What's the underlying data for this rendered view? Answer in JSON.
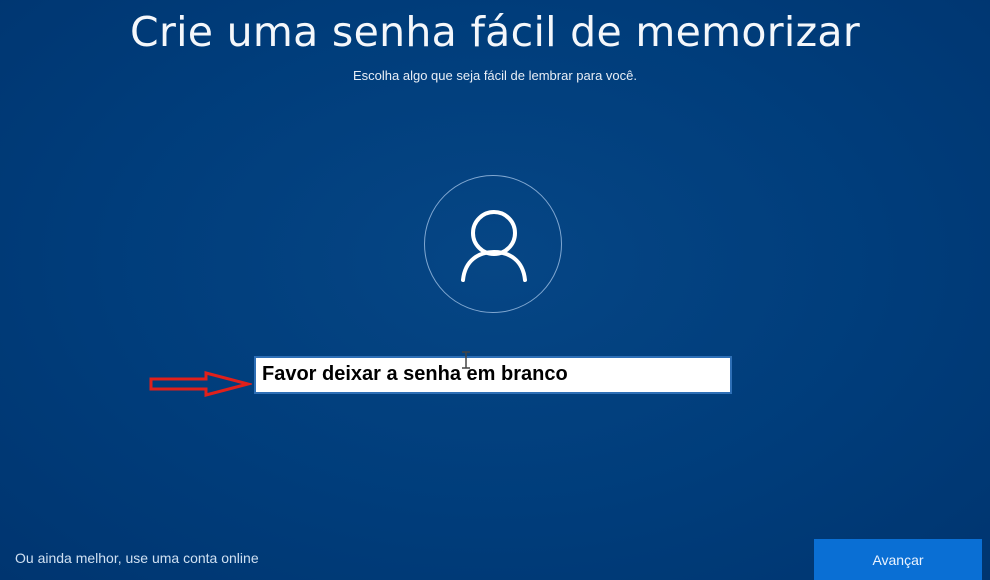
{
  "page": {
    "title": "Crie uma senha fácil de memorizar",
    "subtitle": "Escolha algo que seja fácil de lembrar para você."
  },
  "avatar": {
    "icon": "user-icon"
  },
  "password_field": {
    "value": "Favor deixar a senha em branco"
  },
  "annotation": {
    "icon": "red-arrow-right-icon",
    "color": "#e0201b"
  },
  "footer": {
    "online_account_link": "Ou ainda melhor, use uma conta online",
    "next_button": "Avançar"
  },
  "colors": {
    "background": "#003a78",
    "accent_button": "#0a6fd4",
    "field_border": "#2e6fb6"
  }
}
